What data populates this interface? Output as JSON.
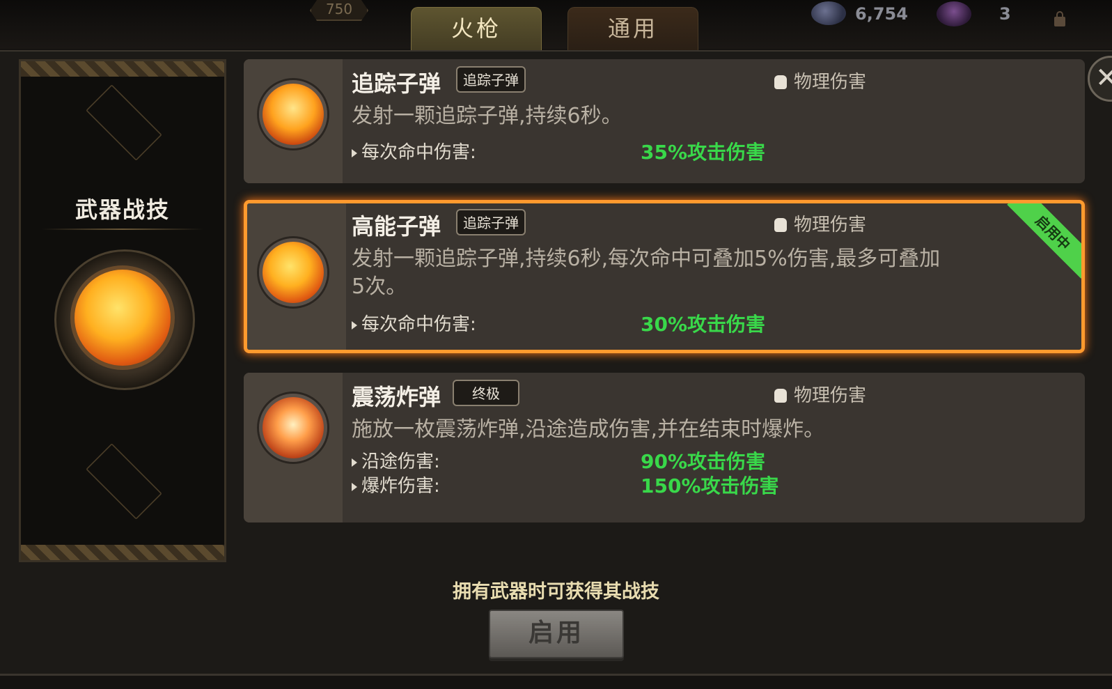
{
  "topbar": {
    "badge": "750",
    "tabs": [
      {
        "label": "火枪",
        "active": true
      },
      {
        "label": "通用",
        "active": false
      }
    ],
    "coin_count": "6,754",
    "gem_count": "3"
  },
  "weapon_panel": {
    "title": "武器战技"
  },
  "skills": [
    {
      "name": "追踪子弹",
      "tag": "追踪子弹",
      "damage_type": "物理伤害",
      "description": "发射一颗追踪子弹,持续6秒。",
      "stats": [
        {
          "label": "每次命中伤害:",
          "value": "35%攻击伤害"
        }
      ]
    },
    {
      "name": "高能子弹",
      "tag": "追踪子弹",
      "damage_type": "物理伤害",
      "description": "发射一颗追踪子弹,持续6秒,每次命中可叠加5%伤害,最多可叠加5次。",
      "stats": [
        {
          "label": "每次命中伤害:",
          "value": "30%攻击伤害"
        }
      ],
      "active_label": "启用中"
    },
    {
      "name": "震荡炸弹",
      "tag": "终极",
      "damage_type": "物理伤害",
      "description": "施放一枚震荡炸弹,沿途造成伤害,并在结束时爆炸。",
      "stats": [
        {
          "label": "沿途伤害:",
          "value": "90%攻击伤害"
        },
        {
          "label": "爆炸伤害:",
          "value": "150%攻击伤害"
        }
      ]
    }
  ],
  "footer": {
    "hint": "拥有武器时可获得其战技",
    "enable_button": "启用"
  },
  "colors": {
    "accent_orange": "#ff9a2e",
    "stat_green": "#39d84a",
    "active_ribbon": "#4fd14a"
  }
}
